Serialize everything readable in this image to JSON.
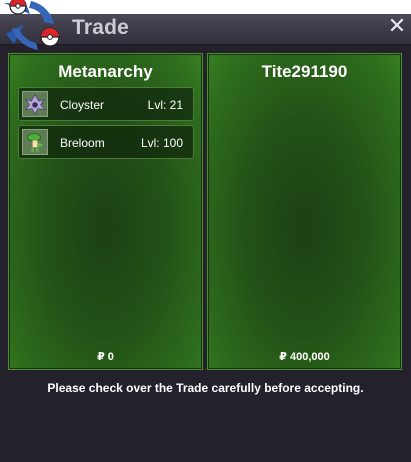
{
  "window": {
    "title": "Trade",
    "close_icon": "close-icon",
    "logo_icon": "pokeball-logo-icon"
  },
  "left_panel": {
    "trainer": "Metanarchy",
    "pokemon": [
      {
        "name": "Cloyster",
        "level": "Lvl: 21",
        "icon": "cloyster-sprite-icon"
      },
      {
        "name": "Breloom",
        "level": "Lvl: 100",
        "icon": "breloom-sprite-icon"
      }
    ],
    "money": "₽ 0"
  },
  "right_panel": {
    "trainer": "Tite291190",
    "pokemon": [],
    "money": "₽ 400,000"
  },
  "notice": "Please check over the Trade carefully before accepting.",
  "colors": {
    "panel_green": "#235217",
    "panel_border": "#4d8f2c",
    "window_bg": "#24212d",
    "title_text": "#cfcbd6"
  }
}
